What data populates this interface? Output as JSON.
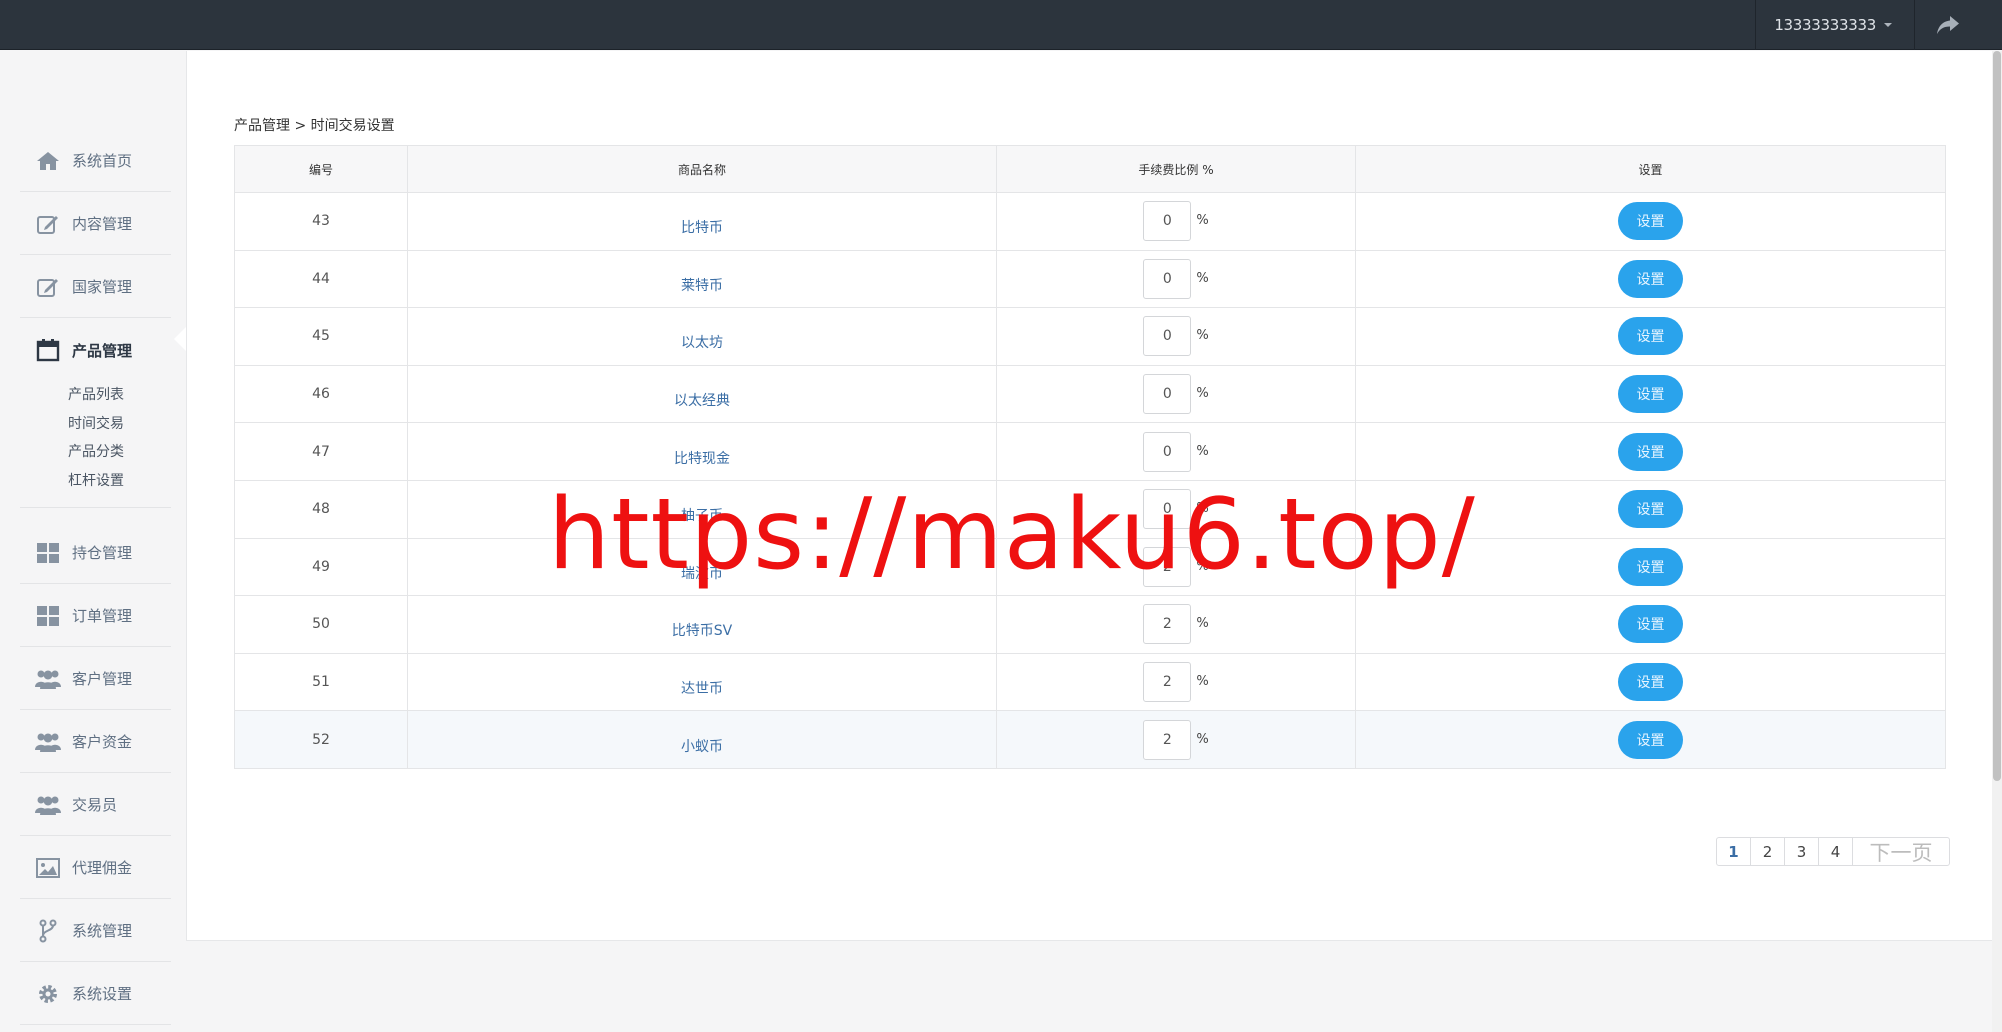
{
  "header": {
    "username": "13333333333",
    "share_icon": "share-arrow-icon"
  },
  "sidebar": {
    "items": [
      {
        "label": "系统首页",
        "icon": "home-icon"
      },
      {
        "label": "内容管理",
        "icon": "edit-icon"
      },
      {
        "label": "国家管理",
        "icon": "edit-icon"
      },
      {
        "label": "产品管理",
        "icon": "calendar-icon",
        "active": true
      },
      {
        "label": "持仓管理",
        "icon": "grid-icon"
      },
      {
        "label": "订单管理",
        "icon": "grid-icon"
      },
      {
        "label": "客户管理",
        "icon": "users-icon"
      },
      {
        "label": "客户资金",
        "icon": "users-icon"
      },
      {
        "label": "交易员",
        "icon": "users-icon"
      },
      {
        "label": "代理佣金",
        "icon": "image-icon"
      },
      {
        "label": "系统管理",
        "icon": "branch-icon"
      },
      {
        "label": "系统设置",
        "icon": "gear-icon"
      }
    ],
    "subitems": [
      "产品列表",
      "时间交易",
      "产品分类",
      "杠杆设置"
    ]
  },
  "breadcrumb": "产品管理 > 时间交易设置",
  "table": {
    "headers": [
      "编号",
      "商品名称",
      "手续费比例 %",
      "设置"
    ],
    "percent_sign": "%",
    "button_label": "设置",
    "rows": [
      {
        "id": "43",
        "name": "比特币",
        "fee": "0"
      },
      {
        "id": "44",
        "name": "莱特币",
        "fee": "0"
      },
      {
        "id": "45",
        "name": "以太坊",
        "fee": "0"
      },
      {
        "id": "46",
        "name": "以太经典",
        "fee": "0"
      },
      {
        "id": "47",
        "name": "比特现金",
        "fee": "0"
      },
      {
        "id": "48",
        "name": "柚子币",
        "fee": "0"
      },
      {
        "id": "49",
        "name": "瑞波币",
        "fee": "2"
      },
      {
        "id": "50",
        "name": "比特币SV",
        "fee": "2"
      },
      {
        "id": "51",
        "name": "达世币",
        "fee": "2"
      },
      {
        "id": "52",
        "name": "小蚁币",
        "fee": "2"
      }
    ]
  },
  "pagination": {
    "pages": [
      "1",
      "2",
      "3",
      "4"
    ],
    "current": "1",
    "next_label": "下一页"
  },
  "watermark": "https://maku6.top/"
}
